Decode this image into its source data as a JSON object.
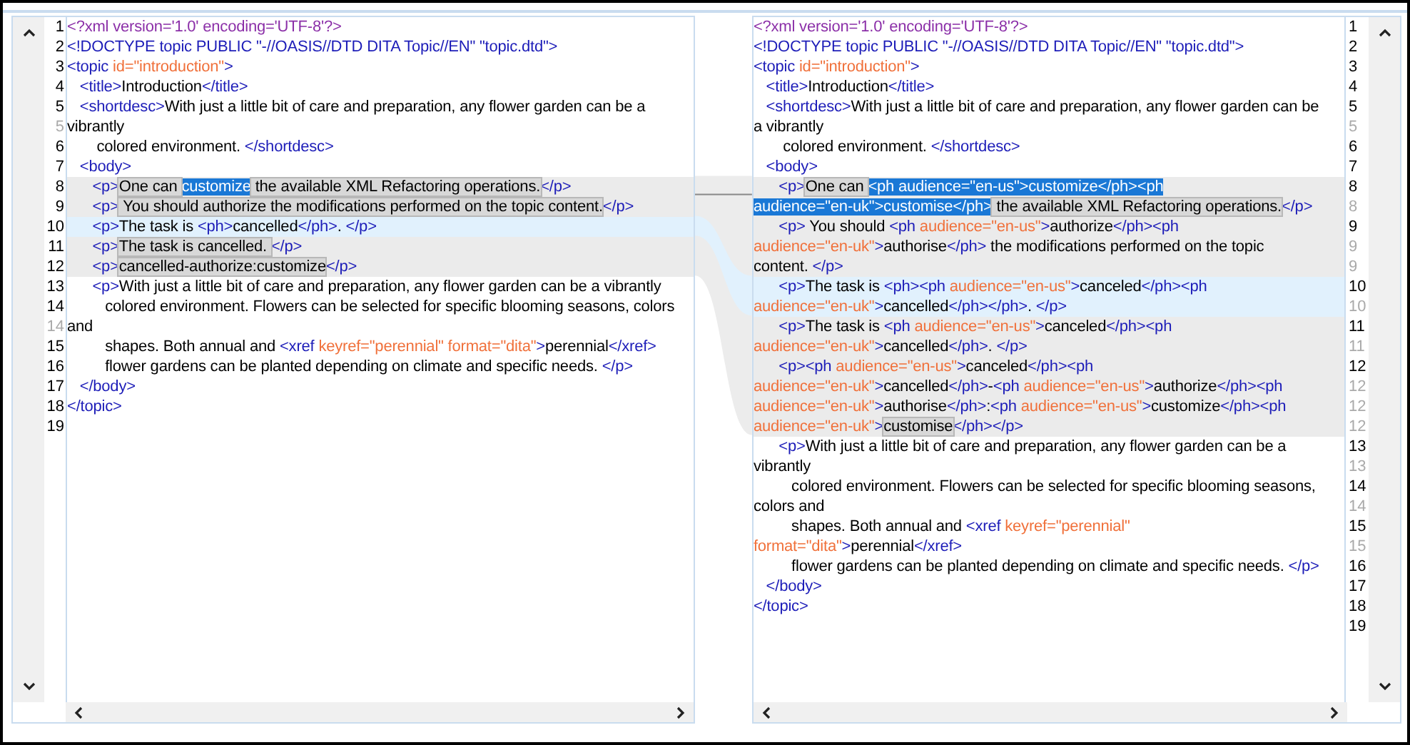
{
  "left_pane": {
    "lines": [
      {
        "number": "1",
        "continuation": false,
        "kind": "plain",
        "segments": [
          {
            "kind": "pi",
            "text": "<?xml version='1.0' encoding='UTF-8'?>"
          }
        ]
      },
      {
        "number": "2",
        "continuation": false,
        "kind": "plain",
        "segments": [
          {
            "kind": "tag",
            "text": "<!DOCTYPE topic PUBLIC \"-//OASIS//DTD DITA Topic//EN\" \"topic.dtd\">"
          }
        ]
      },
      {
        "number": "3",
        "continuation": false,
        "kind": "plain",
        "segments": [
          {
            "kind": "tag",
            "text": "<topic "
          },
          {
            "kind": "attr",
            "text": "id=\"introduction\""
          },
          {
            "kind": "tag",
            "text": ">"
          }
        ]
      },
      {
        "number": "4",
        "continuation": false,
        "kind": "plain",
        "segments": [
          {
            "kind": "tag",
            "text": "   <title>"
          },
          {
            "kind": "text",
            "text": "Introduction"
          },
          {
            "kind": "tag",
            "text": "</title>"
          }
        ]
      },
      {
        "number": "5",
        "continuation": false,
        "kind": "plain",
        "segments": [
          {
            "kind": "tag",
            "text": "   <shortdesc>"
          },
          {
            "kind": "text",
            "text": "With just a little bit of care and preparation, any flower garden can be a"
          }
        ]
      },
      {
        "number": "5",
        "continuation": true,
        "kind": "plain",
        "segments": [
          {
            "kind": "text",
            "text": "vibrantly"
          }
        ]
      },
      {
        "number": "6",
        "continuation": false,
        "kind": "plain",
        "segments": [
          {
            "kind": "text",
            "text": "       colored environment. "
          },
          {
            "kind": "tag",
            "text": "</shortdesc>"
          }
        ]
      },
      {
        "number": "7",
        "continuation": false,
        "kind": "plain",
        "segments": [
          {
            "kind": "tag",
            "text": "   <body>"
          }
        ]
      },
      {
        "number": "8",
        "continuation": false,
        "kind": "changed",
        "segments": [
          {
            "kind": "tag",
            "text": "      <p>"
          },
          {
            "kind": "diff",
            "text": "One can "
          },
          {
            "kind": "selection",
            "text": "customize"
          },
          {
            "kind": "diff",
            "text": " the available XML Refactoring operations."
          },
          {
            "kind": "tag",
            "text": "</p>"
          }
        ]
      },
      {
        "number": "9",
        "continuation": false,
        "kind": "changed",
        "segments": [
          {
            "kind": "tag",
            "text": "      <p>"
          },
          {
            "kind": "diff",
            "text": " You should authorize the modifications performed on the topic content."
          },
          {
            "kind": "tag",
            "text": "</p>"
          }
        ]
      },
      {
        "number": "10",
        "continuation": false,
        "kind": "current",
        "segments": [
          {
            "kind": "tag",
            "text": "      <p>"
          },
          {
            "kind": "text",
            "text": "The task is "
          },
          {
            "kind": "tag",
            "text": "<ph>"
          },
          {
            "kind": "text",
            "text": "cancelled"
          },
          {
            "kind": "tag",
            "text": "</ph>"
          },
          {
            "kind": "text",
            "text": ". "
          },
          {
            "kind": "tag",
            "text": "</p>"
          }
        ]
      },
      {
        "number": "11",
        "continuation": false,
        "kind": "changed",
        "segments": [
          {
            "kind": "tag",
            "text": "      <p>"
          },
          {
            "kind": "diff",
            "text": "The task is cancelled. "
          },
          {
            "kind": "tag",
            "text": "</p>"
          }
        ]
      },
      {
        "number": "12",
        "continuation": false,
        "kind": "changed",
        "segments": [
          {
            "kind": "tag",
            "text": "      <p>"
          },
          {
            "kind": "diff",
            "text": "cancelled-authorize:customize"
          },
          {
            "kind": "tag",
            "text": "</p>"
          }
        ]
      },
      {
        "number": "13",
        "continuation": false,
        "kind": "plain",
        "segments": [
          {
            "kind": "tag",
            "text": "      <p>"
          },
          {
            "kind": "text",
            "text": "With just a little bit of care and preparation, any flower garden can be a vibrantly"
          }
        ]
      },
      {
        "number": "14",
        "continuation": false,
        "kind": "plain",
        "segments": [
          {
            "kind": "text",
            "text": "         colored environment. Flowers can be selected for specific blooming seasons, colors"
          }
        ]
      },
      {
        "number": "14",
        "continuation": true,
        "kind": "plain",
        "segments": [
          {
            "kind": "text",
            "text": "and"
          }
        ]
      },
      {
        "number": "15",
        "continuation": false,
        "kind": "plain",
        "segments": [
          {
            "kind": "text",
            "text": "         shapes. Both annual and "
          },
          {
            "kind": "tag",
            "text": "<xref "
          },
          {
            "kind": "attr",
            "text": "keyref=\"perennial\" format=\"dita\""
          },
          {
            "kind": "tag",
            "text": ">"
          },
          {
            "kind": "text",
            "text": "perennial"
          },
          {
            "kind": "tag",
            "text": "</xref>"
          }
        ]
      },
      {
        "number": "16",
        "continuation": false,
        "kind": "plain",
        "segments": [
          {
            "kind": "text",
            "text": "         flower gardens can be planted depending on climate and specific needs. "
          },
          {
            "kind": "tag",
            "text": "</p>"
          }
        ]
      },
      {
        "number": "17",
        "continuation": false,
        "kind": "plain",
        "segments": [
          {
            "kind": "tag",
            "text": "   </body>"
          }
        ]
      },
      {
        "number": "18",
        "continuation": false,
        "kind": "plain",
        "segments": [
          {
            "kind": "tag",
            "text": "</topic>"
          }
        ]
      },
      {
        "number": "19",
        "continuation": false,
        "kind": "plain"
      }
    ]
  },
  "right_pane": {
    "lines": [
      {
        "number": "1",
        "continuation": false,
        "kind": "plain",
        "segments": [
          {
            "kind": "pi",
            "text": "<?xml version='1.0' encoding='UTF-8'?>"
          }
        ]
      },
      {
        "number": "2",
        "continuation": false,
        "kind": "plain",
        "segments": [
          {
            "kind": "tag",
            "text": "<!DOCTYPE topic PUBLIC \"-//OASIS//DTD DITA Topic//EN\" \"topic.dtd\">"
          }
        ]
      },
      {
        "number": "3",
        "continuation": false,
        "kind": "plain",
        "segments": [
          {
            "kind": "tag",
            "text": "<topic "
          },
          {
            "kind": "attr",
            "text": "id=\"introduction\""
          },
          {
            "kind": "tag",
            "text": ">"
          }
        ]
      },
      {
        "number": "4",
        "continuation": false,
        "kind": "plain",
        "segments": [
          {
            "kind": "tag",
            "text": "   <title>"
          },
          {
            "kind": "text",
            "text": "Introduction"
          },
          {
            "kind": "tag",
            "text": "</title>"
          }
        ]
      },
      {
        "number": "5",
        "continuation": false,
        "kind": "plain",
        "segments": [
          {
            "kind": "tag",
            "text": "   <shortdesc>"
          },
          {
            "kind": "text",
            "text": "With just a little bit of care and preparation, any flower garden can be"
          }
        ]
      },
      {
        "number": "5",
        "continuation": true,
        "kind": "plain",
        "segments": [
          {
            "kind": "text",
            "text": "a vibrantly"
          }
        ]
      },
      {
        "number": "6",
        "continuation": false,
        "kind": "plain",
        "segments": [
          {
            "kind": "text",
            "text": "       colored environment. "
          },
          {
            "kind": "tag",
            "text": "</shortdesc>"
          }
        ]
      },
      {
        "number": "7",
        "continuation": false,
        "kind": "plain",
        "segments": [
          {
            "kind": "tag",
            "text": "   <body>"
          }
        ]
      },
      {
        "number": "8",
        "continuation": false,
        "kind": "changed",
        "segments": [
          {
            "kind": "tag",
            "text": "      <p>"
          },
          {
            "kind": "diff",
            "text": "One can "
          },
          {
            "kind": "selection",
            "text": "<ph audience=\"en-us\">customize</ph><ph"
          }
        ]
      },
      {
        "number": "8",
        "continuation": true,
        "kind": "changed",
        "segments": [
          {
            "kind": "selection",
            "text": "audience=\"en-uk\">customise</ph>"
          },
          {
            "kind": "diff",
            "text": " the available XML Refactoring operations."
          },
          {
            "kind": "tag",
            "text": "</p>"
          }
        ]
      },
      {
        "number": "9",
        "continuation": false,
        "kind": "changed",
        "segments": [
          {
            "kind": "tag",
            "text": "      <p>"
          },
          {
            "kind": "text",
            "text": " You should "
          },
          {
            "kind": "tag",
            "text": "<ph "
          },
          {
            "kind": "attr",
            "text": "audience=\"en-us\""
          },
          {
            "kind": "tag",
            "text": ">"
          },
          {
            "kind": "text",
            "text": "authorize"
          },
          {
            "kind": "tag",
            "text": "</ph><ph"
          }
        ]
      },
      {
        "number": "9",
        "continuation": true,
        "kind": "changed",
        "segments": [
          {
            "kind": "attr",
            "text": "audience=\"en-uk\""
          },
          {
            "kind": "tag",
            "text": ">"
          },
          {
            "kind": "text",
            "text": "authorise"
          },
          {
            "kind": "tag",
            "text": "</ph>"
          },
          {
            "kind": "text",
            "text": " the modifications performed on the topic"
          }
        ]
      },
      {
        "number": "9",
        "continuation": true,
        "kind": "changed",
        "segments": [
          {
            "kind": "text",
            "text": "content. "
          },
          {
            "kind": "tag",
            "text": "</p>"
          }
        ]
      },
      {
        "number": "10",
        "continuation": false,
        "kind": "current",
        "segments": [
          {
            "kind": "tag",
            "text": "      <p>"
          },
          {
            "kind": "text",
            "text": "The task is "
          },
          {
            "kind": "tag",
            "text": "<ph><ph "
          },
          {
            "kind": "attr",
            "text": "audience=\"en-us\""
          },
          {
            "kind": "tag",
            "text": ">"
          },
          {
            "kind": "text",
            "text": "canceled"
          },
          {
            "kind": "tag",
            "text": "</ph><ph"
          }
        ]
      },
      {
        "number": "10",
        "continuation": true,
        "kind": "current",
        "segments": [
          {
            "kind": "attr",
            "text": "audience=\"en-uk\""
          },
          {
            "kind": "tag",
            "text": ">"
          },
          {
            "kind": "text",
            "text": "cancelled"
          },
          {
            "kind": "tag",
            "text": "</ph></ph>"
          },
          {
            "kind": "text",
            "text": ". "
          },
          {
            "kind": "tag",
            "text": "</p>"
          }
        ]
      },
      {
        "number": "11",
        "continuation": false,
        "kind": "changed",
        "segments": [
          {
            "kind": "tag",
            "text": "      <p>"
          },
          {
            "kind": "text",
            "text": "The task is "
          },
          {
            "kind": "tag",
            "text": "<ph "
          },
          {
            "kind": "attr",
            "text": "audience=\"en-us\""
          },
          {
            "kind": "tag",
            "text": ">"
          },
          {
            "kind": "text",
            "text": "canceled"
          },
          {
            "kind": "tag",
            "text": "</ph><ph"
          }
        ]
      },
      {
        "number": "11",
        "continuation": true,
        "kind": "changed",
        "segments": [
          {
            "kind": "attr",
            "text": "audience=\"en-uk\""
          },
          {
            "kind": "tag",
            "text": ">"
          },
          {
            "kind": "text",
            "text": "cancelled"
          },
          {
            "kind": "tag",
            "text": "</ph>"
          },
          {
            "kind": "text",
            "text": ". "
          },
          {
            "kind": "tag",
            "text": "</p>"
          }
        ]
      },
      {
        "number": "12",
        "continuation": false,
        "kind": "changed",
        "segments": [
          {
            "kind": "tag",
            "text": "      <p><ph "
          },
          {
            "kind": "attr",
            "text": "audience=\"en-us\""
          },
          {
            "kind": "tag",
            "text": ">"
          },
          {
            "kind": "text",
            "text": "canceled"
          },
          {
            "kind": "tag",
            "text": "</ph><ph"
          }
        ]
      },
      {
        "number": "12",
        "continuation": true,
        "kind": "changed",
        "segments": [
          {
            "kind": "attr",
            "text": "audience=\"en-uk\""
          },
          {
            "kind": "tag",
            "text": ">"
          },
          {
            "kind": "text",
            "text": "cancelled"
          },
          {
            "kind": "tag",
            "text": "</ph>"
          },
          {
            "kind": "text",
            "text": "-"
          },
          {
            "kind": "tag",
            "text": "<ph "
          },
          {
            "kind": "attr",
            "text": "audience=\"en-us\""
          },
          {
            "kind": "tag",
            "text": ">"
          },
          {
            "kind": "text",
            "text": "authorize"
          },
          {
            "kind": "tag",
            "text": "</ph><ph"
          }
        ]
      },
      {
        "number": "12",
        "continuation": true,
        "kind": "changed",
        "segments": [
          {
            "kind": "attr",
            "text": "audience=\"en-uk\""
          },
          {
            "kind": "tag",
            "text": ">"
          },
          {
            "kind": "text",
            "text": "authorise"
          },
          {
            "kind": "tag",
            "text": "</ph>"
          },
          {
            "kind": "text",
            "text": ":"
          },
          {
            "kind": "tag",
            "text": "<ph "
          },
          {
            "kind": "attr",
            "text": "audience=\"en-us\""
          },
          {
            "kind": "tag",
            "text": ">"
          },
          {
            "kind": "text",
            "text": "customize"
          },
          {
            "kind": "tag",
            "text": "</ph><ph"
          }
        ]
      },
      {
        "number": "12",
        "continuation": true,
        "kind": "changed",
        "segments": [
          {
            "kind": "attr",
            "text": "audience=\"en-uk\""
          },
          {
            "kind": "tag",
            "text": ">"
          },
          {
            "kind": "diff",
            "text": "customise"
          },
          {
            "kind": "tag",
            "text": "</ph></p>"
          }
        ]
      },
      {
        "number": "13",
        "continuation": false,
        "kind": "plain",
        "segments": [
          {
            "kind": "tag",
            "text": "      <p>"
          },
          {
            "kind": "text",
            "text": "With just a little bit of care and preparation, any flower garden can be a"
          }
        ]
      },
      {
        "number": "13",
        "continuation": true,
        "kind": "plain",
        "segments": [
          {
            "kind": "text",
            "text": "vibrantly"
          }
        ]
      },
      {
        "number": "14",
        "continuation": false,
        "kind": "plain",
        "segments": [
          {
            "kind": "text",
            "text": "         colored environment. Flowers can be selected for specific blooming seasons,"
          }
        ]
      },
      {
        "number": "14",
        "continuation": true,
        "kind": "plain",
        "segments": [
          {
            "kind": "text",
            "text": "colors and"
          }
        ]
      },
      {
        "number": "15",
        "continuation": false,
        "kind": "plain",
        "segments": [
          {
            "kind": "text",
            "text": "         shapes. Both annual and "
          },
          {
            "kind": "tag",
            "text": "<xref "
          },
          {
            "kind": "attr",
            "text": "keyref=\"perennial\""
          }
        ]
      },
      {
        "number": "15",
        "continuation": true,
        "kind": "plain",
        "segments": [
          {
            "kind": "attr",
            "text": "format=\"dita\""
          },
          {
            "kind": "tag",
            "text": ">"
          },
          {
            "kind": "text",
            "text": "perennial"
          },
          {
            "kind": "tag",
            "text": "</xref>"
          }
        ]
      },
      {
        "number": "16",
        "continuation": false,
        "kind": "plain",
        "segments": [
          {
            "kind": "text",
            "text": "         flower gardens can be planted depending on climate and specific needs. "
          },
          {
            "kind": "tag",
            "text": "</p>"
          }
        ]
      },
      {
        "number": "17",
        "continuation": false,
        "kind": "plain",
        "segments": [
          {
            "kind": "tag",
            "text": "   </body>"
          }
        ]
      },
      {
        "number": "18",
        "continuation": false,
        "kind": "plain",
        "segments": [
          {
            "kind": "tag",
            "text": "</topic>"
          }
        ]
      },
      {
        "number": "19",
        "continuation": false,
        "kind": "plain"
      }
    ]
  }
}
